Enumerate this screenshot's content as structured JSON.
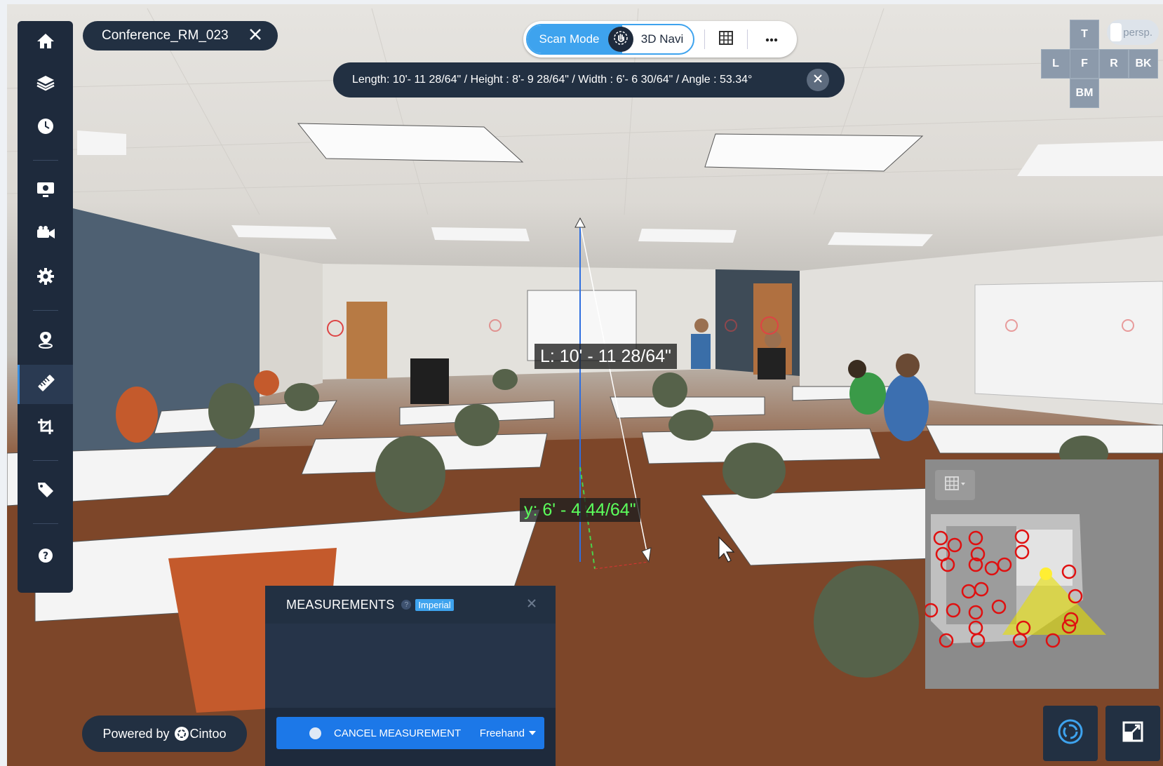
{
  "scan": {
    "name": "Conference_RM_023"
  },
  "modebar": {
    "scan_mode_label": "Scan Mode",
    "nav_label": "3D Navi"
  },
  "measurement_info": {
    "text": "Length: 10'- 11 28/64\" / Height : 8'- 9 28/64\" / Width : 6'- 6 30/64\" / Angle : 53.34°"
  },
  "view_cube": {
    "top": "T",
    "left": "L",
    "front": "F",
    "right": "R",
    "back": "BK",
    "bottom": "BM",
    "projection": "persp."
  },
  "scene_labels": {
    "length": "L: 10' - 11 28/64\"",
    "y": "y: 6' - 4 44/64\""
  },
  "measurements_panel": {
    "title": "MEASUREMENTS",
    "info_glyph": "?",
    "units_badge": "Imperial",
    "cancel_label": "CANCEL MEASUREMENT",
    "mode_label": "Freehand"
  },
  "powered": {
    "prefix": "Powered by",
    "brand": "Cintoo"
  },
  "toolbar": {
    "active": "measure"
  },
  "colors": {
    "accent": "#3ea3ee",
    "panel": "#1e2a3c",
    "primary_button": "#1c78e8",
    "y_axis": "#5cff5c"
  }
}
